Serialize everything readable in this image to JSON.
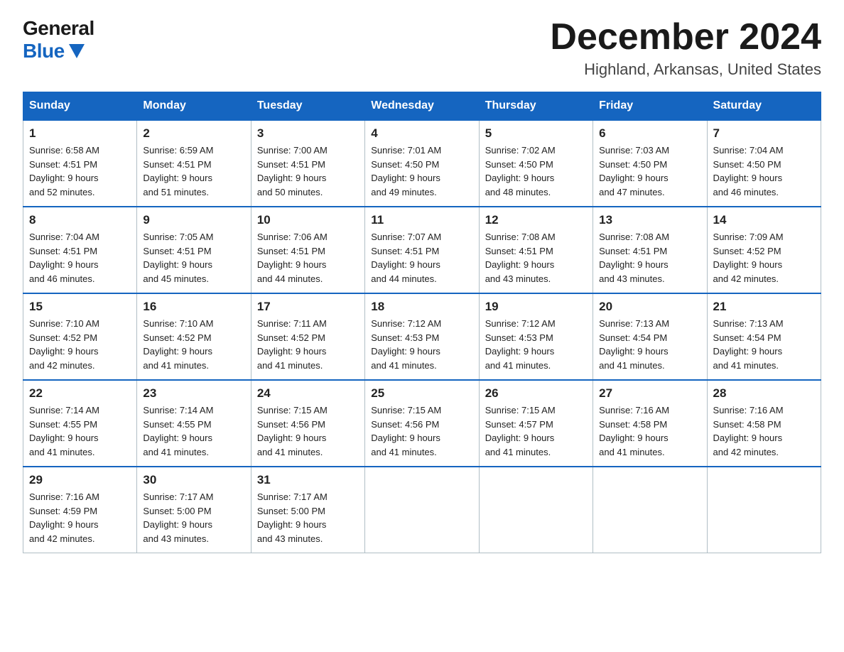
{
  "logo": {
    "general": "General",
    "blue": "Blue"
  },
  "title": "December 2024",
  "location": "Highland, Arkansas, United States",
  "days_of_week": [
    "Sunday",
    "Monday",
    "Tuesday",
    "Wednesday",
    "Thursday",
    "Friday",
    "Saturday"
  ],
  "weeks": [
    [
      {
        "day": "1",
        "sunrise": "6:58 AM",
        "sunset": "4:51 PM",
        "daylight": "9 hours and 52 minutes."
      },
      {
        "day": "2",
        "sunrise": "6:59 AM",
        "sunset": "4:51 PM",
        "daylight": "9 hours and 51 minutes."
      },
      {
        "day": "3",
        "sunrise": "7:00 AM",
        "sunset": "4:51 PM",
        "daylight": "9 hours and 50 minutes."
      },
      {
        "day": "4",
        "sunrise": "7:01 AM",
        "sunset": "4:50 PM",
        "daylight": "9 hours and 49 minutes."
      },
      {
        "day": "5",
        "sunrise": "7:02 AM",
        "sunset": "4:50 PM",
        "daylight": "9 hours and 48 minutes."
      },
      {
        "day": "6",
        "sunrise": "7:03 AM",
        "sunset": "4:50 PM",
        "daylight": "9 hours and 47 minutes."
      },
      {
        "day": "7",
        "sunrise": "7:04 AM",
        "sunset": "4:50 PM",
        "daylight": "9 hours and 46 minutes."
      }
    ],
    [
      {
        "day": "8",
        "sunrise": "7:04 AM",
        "sunset": "4:51 PM",
        "daylight": "9 hours and 46 minutes."
      },
      {
        "day": "9",
        "sunrise": "7:05 AM",
        "sunset": "4:51 PM",
        "daylight": "9 hours and 45 minutes."
      },
      {
        "day": "10",
        "sunrise": "7:06 AM",
        "sunset": "4:51 PM",
        "daylight": "9 hours and 44 minutes."
      },
      {
        "day": "11",
        "sunrise": "7:07 AM",
        "sunset": "4:51 PM",
        "daylight": "9 hours and 44 minutes."
      },
      {
        "day": "12",
        "sunrise": "7:08 AM",
        "sunset": "4:51 PM",
        "daylight": "9 hours and 43 minutes."
      },
      {
        "day": "13",
        "sunrise": "7:08 AM",
        "sunset": "4:51 PM",
        "daylight": "9 hours and 43 minutes."
      },
      {
        "day": "14",
        "sunrise": "7:09 AM",
        "sunset": "4:52 PM",
        "daylight": "9 hours and 42 minutes."
      }
    ],
    [
      {
        "day": "15",
        "sunrise": "7:10 AM",
        "sunset": "4:52 PM",
        "daylight": "9 hours and 42 minutes."
      },
      {
        "day": "16",
        "sunrise": "7:10 AM",
        "sunset": "4:52 PM",
        "daylight": "9 hours and 41 minutes."
      },
      {
        "day": "17",
        "sunrise": "7:11 AM",
        "sunset": "4:52 PM",
        "daylight": "9 hours and 41 minutes."
      },
      {
        "day": "18",
        "sunrise": "7:12 AM",
        "sunset": "4:53 PM",
        "daylight": "9 hours and 41 minutes."
      },
      {
        "day": "19",
        "sunrise": "7:12 AM",
        "sunset": "4:53 PM",
        "daylight": "9 hours and 41 minutes."
      },
      {
        "day": "20",
        "sunrise": "7:13 AM",
        "sunset": "4:54 PM",
        "daylight": "9 hours and 41 minutes."
      },
      {
        "day": "21",
        "sunrise": "7:13 AM",
        "sunset": "4:54 PM",
        "daylight": "9 hours and 41 minutes."
      }
    ],
    [
      {
        "day": "22",
        "sunrise": "7:14 AM",
        "sunset": "4:55 PM",
        "daylight": "9 hours and 41 minutes."
      },
      {
        "day": "23",
        "sunrise": "7:14 AM",
        "sunset": "4:55 PM",
        "daylight": "9 hours and 41 minutes."
      },
      {
        "day": "24",
        "sunrise": "7:15 AM",
        "sunset": "4:56 PM",
        "daylight": "9 hours and 41 minutes."
      },
      {
        "day": "25",
        "sunrise": "7:15 AM",
        "sunset": "4:56 PM",
        "daylight": "9 hours and 41 minutes."
      },
      {
        "day": "26",
        "sunrise": "7:15 AM",
        "sunset": "4:57 PM",
        "daylight": "9 hours and 41 minutes."
      },
      {
        "day": "27",
        "sunrise": "7:16 AM",
        "sunset": "4:58 PM",
        "daylight": "9 hours and 41 minutes."
      },
      {
        "day": "28",
        "sunrise": "7:16 AM",
        "sunset": "4:58 PM",
        "daylight": "9 hours and 42 minutes."
      }
    ],
    [
      {
        "day": "29",
        "sunrise": "7:16 AM",
        "sunset": "4:59 PM",
        "daylight": "9 hours and 42 minutes."
      },
      {
        "day": "30",
        "sunrise": "7:17 AM",
        "sunset": "5:00 PM",
        "daylight": "9 hours and 43 minutes."
      },
      {
        "day": "31",
        "sunrise": "7:17 AM",
        "sunset": "5:00 PM",
        "daylight": "9 hours and 43 minutes."
      },
      null,
      null,
      null,
      null
    ]
  ]
}
